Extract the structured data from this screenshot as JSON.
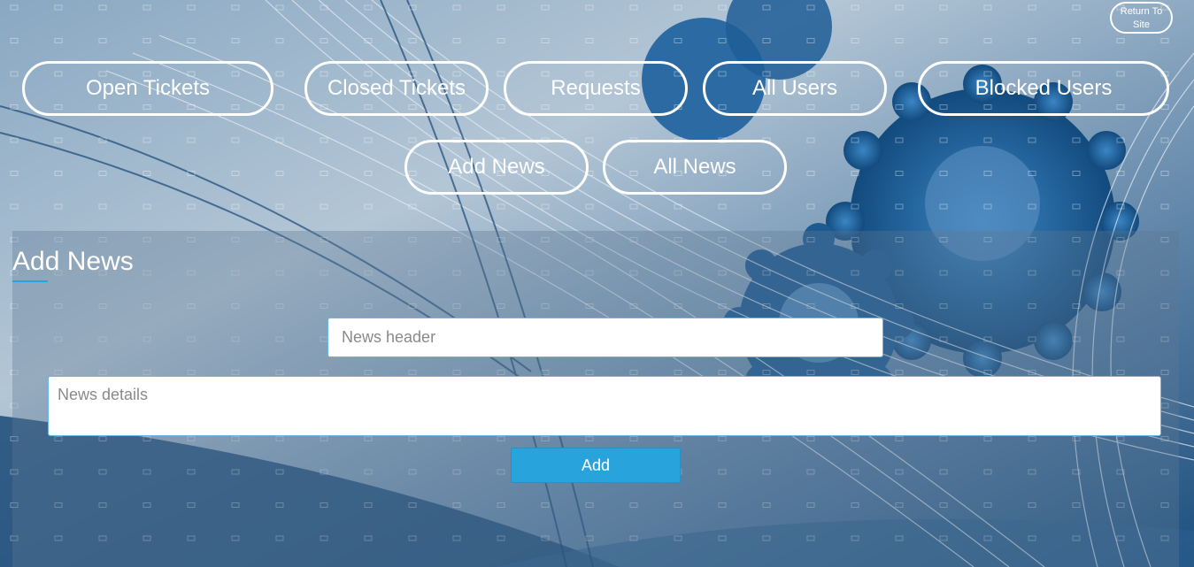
{
  "header": {
    "return_link": "Return To Site"
  },
  "nav": {
    "open_tickets": "Open Tickets",
    "closed_tickets": "Closed Tickets",
    "requests": "Requests",
    "all_users": "All Users",
    "blocked_users": "Blocked Users",
    "add_news": "Add News",
    "all_news": "All News"
  },
  "form": {
    "title": "Add News",
    "header_placeholder": "News header",
    "header_value": "",
    "details_placeholder": "News details",
    "details_value": "",
    "submit_label": "Add"
  },
  "colors": {
    "accent": "#29a3dc",
    "pill_border": "#ffffff",
    "background": "#6f8faf"
  },
  "icons": {
    "background_art": "gears-and-lines-background"
  }
}
